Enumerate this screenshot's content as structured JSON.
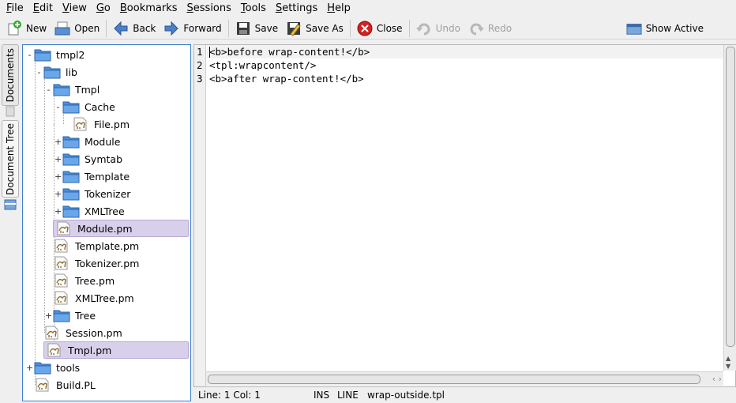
{
  "menu": {
    "items": [
      {
        "acc": "F",
        "rest": "ile"
      },
      {
        "acc": "E",
        "rest": "dit"
      },
      {
        "acc": "V",
        "rest": "iew"
      },
      {
        "acc": "G",
        "rest": "o"
      },
      {
        "acc": "B",
        "rest": "ookmarks"
      },
      {
        "acc": "S",
        "rest": "essions"
      },
      {
        "acc": "T",
        "rest": "ools"
      },
      {
        "acc": "S",
        "rest": "ettings"
      },
      {
        "acc": "H",
        "rest": "elp"
      }
    ]
  },
  "toolbar": {
    "new": "New",
    "open": "Open",
    "back": "Back",
    "forward": "Forward",
    "save": "Save",
    "save_as": "Save As",
    "close": "Close",
    "undo": "Undo",
    "redo": "Redo",
    "show_active": "Show Active"
  },
  "side_tabs": {
    "documents": "Documents",
    "document_tree": "Document Tree"
  },
  "tree": {
    "nodes": [
      {
        "label": "tmpl2",
        "type": "folder",
        "expander": "-"
      },
      {
        "label": "lib",
        "type": "folder",
        "expander": "-"
      },
      {
        "label": "Tmpl",
        "type": "folder",
        "expander": "-"
      },
      {
        "label": "Cache",
        "type": "folder",
        "expander": "-"
      },
      {
        "label": "File.pm",
        "type": "file",
        "expander": ""
      },
      {
        "label": "Module",
        "type": "folder",
        "expander": "+"
      },
      {
        "label": "Symtab",
        "type": "folder",
        "expander": "+"
      },
      {
        "label": "Template",
        "type": "folder",
        "expander": "+"
      },
      {
        "label": "Tokenizer",
        "type": "folder",
        "expander": "+"
      },
      {
        "label": "XMLTree",
        "type": "folder",
        "expander": "+"
      },
      {
        "label": "Module.pm",
        "type": "file",
        "expander": ""
      },
      {
        "label": "Template.pm",
        "type": "file",
        "expander": ""
      },
      {
        "label": "Tokenizer.pm",
        "type": "file",
        "expander": ""
      },
      {
        "label": "Tree.pm",
        "type": "file",
        "expander": ""
      },
      {
        "label": "XMLTree.pm",
        "type": "file",
        "expander": ""
      },
      {
        "label": "Tree",
        "type": "folder",
        "expander": "+"
      },
      {
        "label": "Session.pm",
        "type": "file",
        "expander": ""
      },
      {
        "label": "Tmpl.pm",
        "type": "file",
        "expander": ""
      },
      {
        "label": "tools",
        "type": "folder",
        "expander": "+"
      },
      {
        "label": "Build.PL",
        "type": "file",
        "expander": ""
      }
    ]
  },
  "editor": {
    "line_numbers": [
      "1",
      "2",
      "3"
    ],
    "lines": [
      "<b>before wrap-content!</b>",
      "<tpl:wrapcontent/>",
      "<b>after wrap-content!</b>"
    ]
  },
  "status": {
    "position": "Line: 1 Col: 1",
    "mode": "INS",
    "selection": "LINE",
    "filename": "wrap-outside.tpl"
  },
  "colors": {
    "tree_border": "#3e7fcf",
    "selection": "#d8d0ea",
    "folder": "#4a8fdc"
  }
}
